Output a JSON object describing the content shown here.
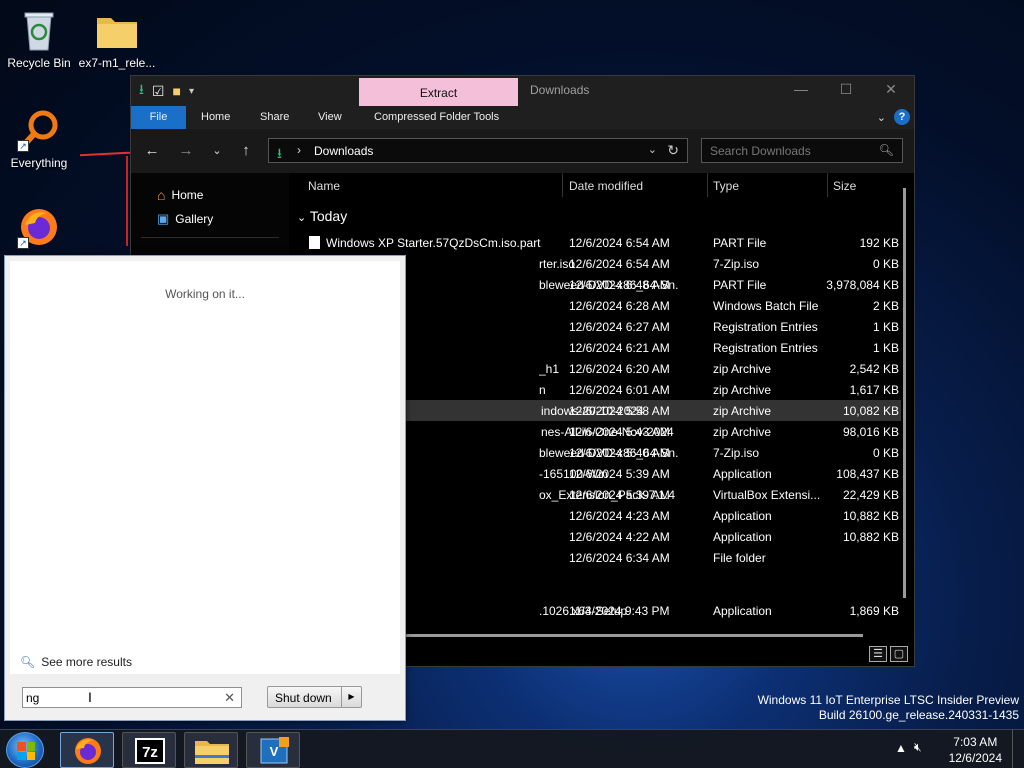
{
  "desktop": {
    "icons": [
      {
        "label": "Recycle Bin",
        "icon": "recycle-bin-icon"
      },
      {
        "label": "ex7-m1_rele...",
        "icon": "folder-icon"
      },
      {
        "label": "Everything",
        "icon": "everything-search-icon"
      },
      {
        "label": "",
        "icon": "firefox-icon"
      }
    ]
  },
  "explorer": {
    "context_tab": "Extract",
    "title": "Downloads",
    "ribbon_tabs": [
      "File",
      "Home",
      "Share",
      "View",
      "Compressed Folder Tools"
    ],
    "address": {
      "crumb": "Downloads"
    },
    "search_placeholder": "Search Downloads",
    "nav_items": [
      "Home",
      "Gallery"
    ],
    "columns": [
      "Name",
      "Date modified",
      "Type",
      "Size"
    ],
    "group": "Today",
    "rows": [
      {
        "name": "Windows XP Starter.57QzDsCm.iso.part",
        "date": "12/6/2024 6:54 AM",
        "type": "PART File",
        "size": "192 KB"
      },
      {
        "name": "rter.iso",
        "date": "12/6/2024 6:54 AM",
        "type": "7-Zip.iso",
        "size": "0 KB"
      },
      {
        "name": "bleweed-DVD-x86_64-Sn...",
        "date": "12/6/2024 6:48 AM",
        "type": "PART File",
        "size": "3,978,084 KB"
      },
      {
        "name": "",
        "date": "12/6/2024 6:28 AM",
        "type": "Windows Batch File",
        "size": "2 KB"
      },
      {
        "name": "",
        "date": "12/6/2024 6:27 AM",
        "type": "Registration Entries",
        "size": "1 KB"
      },
      {
        "name": "",
        "date": "12/6/2024 6:21 AM",
        "type": "Registration Entries",
        "size": "1 KB"
      },
      {
        "name": "_h1",
        "date": "12/6/2024 6:20 AM",
        "type": "zip Archive",
        "size": "2,542 KB"
      },
      {
        "name": "n",
        "date": "12/6/2024 6:01 AM",
        "type": "zip Archive",
        "size": "1,617 KB"
      },
      {
        "name": "indows-20-10-2024",
        "date": "12/6/2024 5:58 AM",
        "type": "zip Archive",
        "size": "10,082 KB"
      },
      {
        "name": "nes-All-in-One-Nov-2024",
        "date": "12/6/2024 5:43 AM",
        "type": "zip Archive",
        "size": "98,016 KB"
      },
      {
        "name": "bleweed-DVD-x86_64-Sn...",
        "date": "12/6/2024 5:40 AM",
        "type": "7-Zip.iso",
        "size": "0 KB"
      },
      {
        "name": "-165100-Win",
        "date": "12/6/2024 5:39 AM",
        "type": "Application",
        "size": "108,437 KB"
      },
      {
        "name": "ox_Extension_Pack-7.1.4",
        "date": "12/6/2024 5:39 AM",
        "type": "VirtualBox Extensi...",
        "size": "22,429 KB"
      },
      {
        "name": "",
        "date": "12/6/2024 4:23 AM",
        "type": "Application",
        "size": "10,882 KB"
      },
      {
        "name": "",
        "date": "12/6/2024 4:22 AM",
        "type": "Application",
        "size": "10,882 KB"
      },
      {
        "name": "",
        "date": "12/6/2024 6:34 AM",
        "type": "File folder",
        "size": ""
      },
      {
        "name": ".1026.x64-Setup",
        "date": "11/3/2024 9:43 PM",
        "type": "Application",
        "size": "1,869 KB"
      }
    ]
  },
  "startmenu": {
    "status": "Working on it...",
    "see_more": "See more results",
    "search_value": "ng",
    "shutdown_label": "Shut down"
  },
  "watermark": {
    "line1": "Windows 11 IoT Enterprise LTSC Insider Preview",
    "line2": "Build 26100.ge_release.240331-1435"
  },
  "taskbar": {
    "time": "7:03 AM",
    "date": "12/6/2024",
    "apps": [
      "firefox-icon",
      "7zip-icon",
      "file-explorer-icon",
      "virtualbox-icon"
    ]
  },
  "colors": {
    "accent": "#1a6fc9",
    "context_tab": "#f4bfd8",
    "selected_row": "#333333"
  }
}
